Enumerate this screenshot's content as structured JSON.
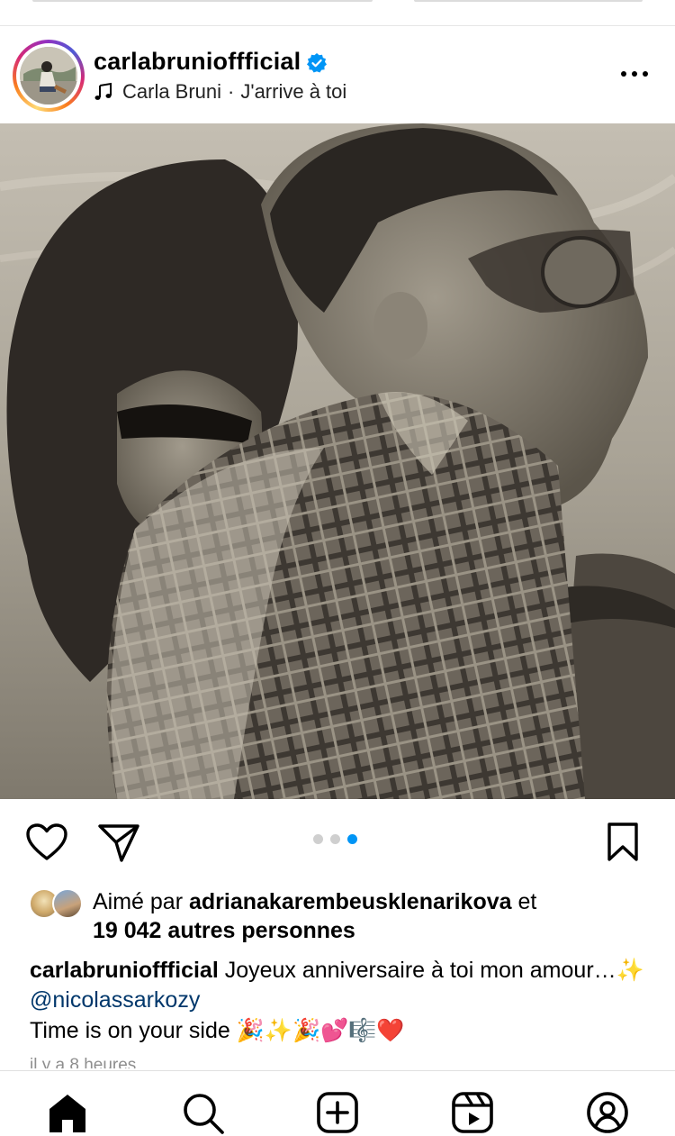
{
  "post": {
    "username": "carlabrunioffficial",
    "verified": true,
    "audio": {
      "artist": "Carla Bruni",
      "separator": "·",
      "title": "J'arrive à toi"
    },
    "carousel": {
      "count": 3,
      "active_index": 2
    },
    "likes": {
      "prefix": "Aimé par",
      "user": "adrianakarembeusklenarikova",
      "conjunction": "et",
      "others": "19 042 autres personnes"
    },
    "caption": {
      "username": "carlabrunioffficial",
      "text": "Joyeux anniversaire à toi mon amour…",
      "sparkle": "✨",
      "mention": "@nicolassarkozy",
      "line2": "Time is on your side",
      "emojis": "🎉✨🎉💕🎼❤️"
    },
    "time_ago": "il y a 8 heures"
  },
  "colors": {
    "accent": "#0095f6",
    "link": "#00376b",
    "muted": "#8e8e8e"
  },
  "icons": {
    "more": "more-horizontal-icon",
    "mute": "speaker-muted-icon",
    "like": "heart-icon",
    "share": "paper-plane-icon",
    "save": "bookmark-icon",
    "nav": [
      "home-icon",
      "search-icon",
      "create-icon",
      "reels-icon",
      "profile-icon"
    ]
  }
}
